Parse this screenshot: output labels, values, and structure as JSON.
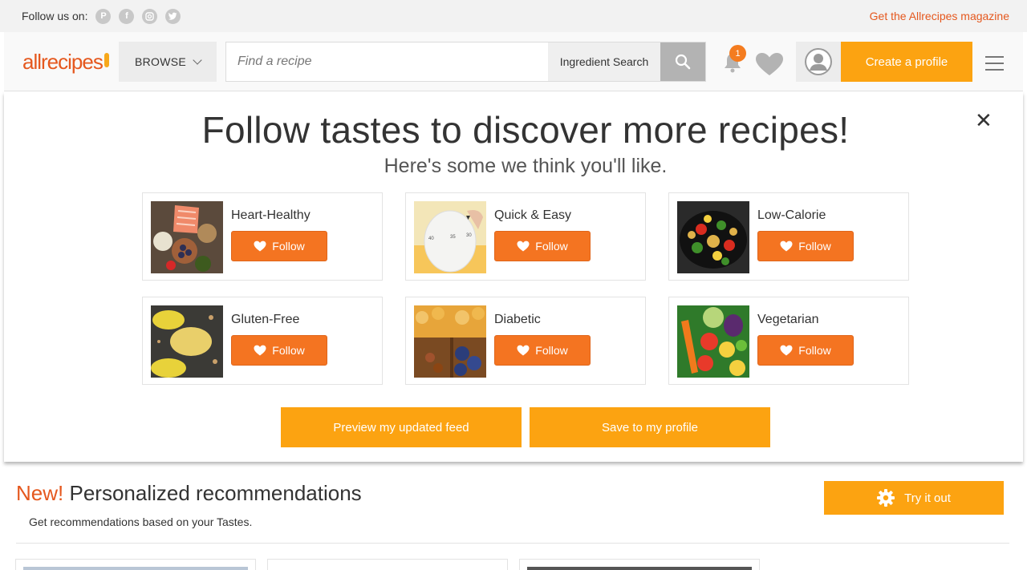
{
  "topbar": {
    "follow_label": "Follow us on:",
    "social_icons": [
      "pinterest-icon",
      "facebook-icon",
      "instagram-icon",
      "twitter-icon"
    ],
    "magazine_link": "Get the Allrecipes magazine"
  },
  "header": {
    "logo_text": "allrecipes",
    "browse_label": "BROWSE",
    "search_placeholder": "Find a recipe",
    "search_value": "",
    "ingredient_search_label": "Ingredient Search",
    "notification_count": "1",
    "create_profile_label": "Create a profile"
  },
  "tastes_panel": {
    "title": "Follow tastes to discover more recipes!",
    "subtitle": "Here's some we think you'll like.",
    "close_label": "✕",
    "follow_label": "Follow",
    "tastes": [
      {
        "name": "Heart-Healthy"
      },
      {
        "name": "Quick & Easy"
      },
      {
        "name": "Low-Calorie"
      },
      {
        "name": "Gluten-Free"
      },
      {
        "name": "Diabetic"
      },
      {
        "name": "Vegetarian"
      }
    ],
    "preview_button": "Preview my updated feed",
    "save_button": "Save to my profile"
  },
  "recommendations": {
    "new_label": "New!",
    "title": "Personalized recommendations",
    "subtitle": "Get recommendations based on your Tastes.",
    "try_button": "Try it out"
  },
  "colors": {
    "brand_orange": "#e5581e",
    "follow_orange": "#f47421",
    "cta_yellow": "#fca311"
  }
}
